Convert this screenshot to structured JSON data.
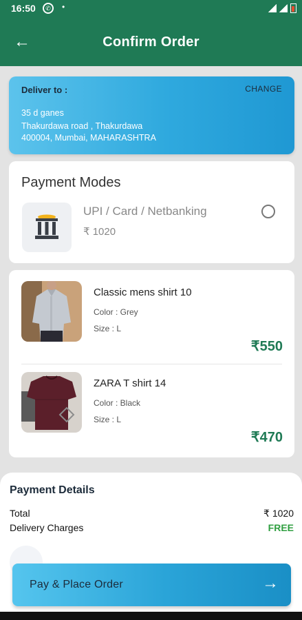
{
  "status_bar": {
    "time": "16:50",
    "dot": "•"
  },
  "app_bar": {
    "back_glyph": "←",
    "title": "Confirm Order"
  },
  "delivery": {
    "label": "Deliver to :",
    "change": "CHANGE",
    "address_lines": [
      "35 d ganes",
      "Thakurdawa road , Thakurdawa",
      "400004, Mumbai, MAHARASHTRA"
    ]
  },
  "payment_modes": {
    "heading": "Payment Modes",
    "option_label": "UPI / Card / Netbanking",
    "option_amount": "₹ 1020",
    "icon": "bank-icon"
  },
  "items": [
    {
      "name": "Classic mens shirt 10",
      "color": "Color : Grey",
      "size": "Size : L",
      "price": "₹550"
    },
    {
      "name": "ZARA T shirt 14",
      "color": "Color : Black",
      "size": "Size : L",
      "price": "₹470"
    }
  ],
  "payment_details": {
    "title": "Payment Details",
    "total_label": "Total",
    "total_value": "₹ 1020",
    "delivery_label": "Delivery Charges",
    "delivery_value": "FREE"
  },
  "pay_button": {
    "label": "Pay & Place Order",
    "arrow": "→"
  },
  "colors": {
    "primary": "#1f7a55",
    "accent_blue": "#2fa9de",
    "free_green": "#2e9e3f"
  }
}
